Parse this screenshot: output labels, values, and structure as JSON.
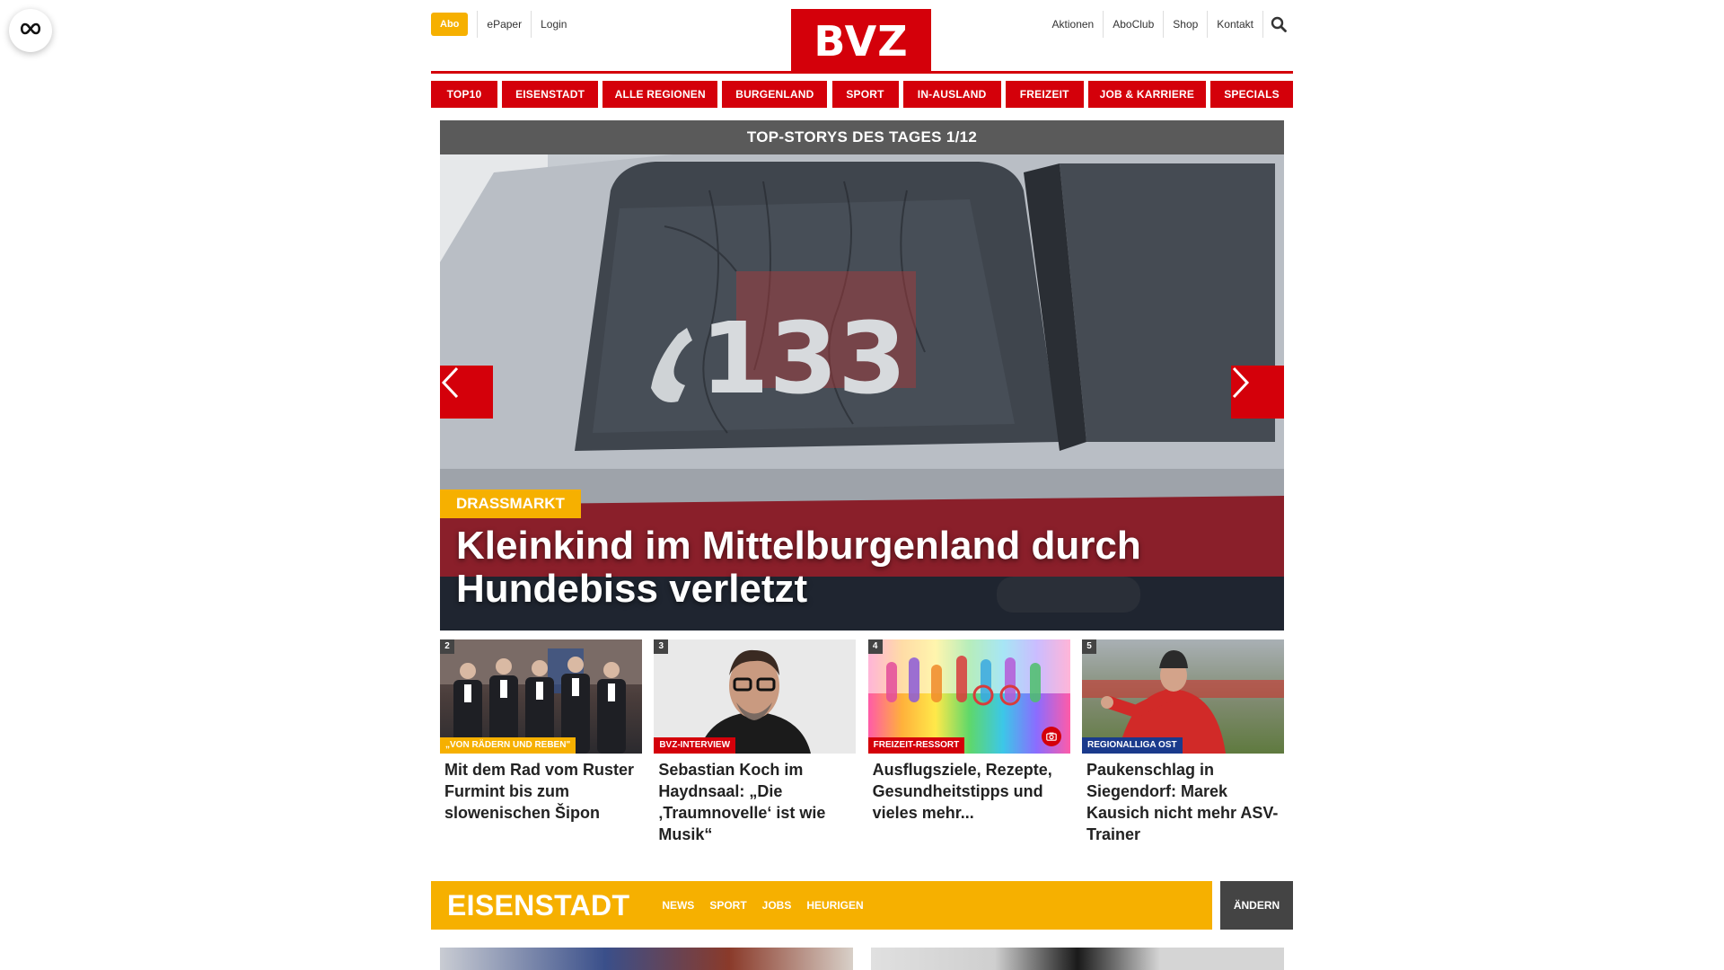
{
  "header": {
    "abo_label": "Abo",
    "left_links": [
      "ePaper",
      "Login"
    ],
    "logo_text": "BVZ",
    "right_links": [
      "Aktionen",
      "AboClub",
      "Shop",
      "Kontakt"
    ]
  },
  "nav": {
    "categories": [
      "TOP10",
      "EISENSTADT",
      "ALLE REGIONEN",
      "BURGENLAND",
      "SPORT",
      "IN-AUSLAND",
      "FREIZEIT",
      "JOB & KARRIERE",
      "SPECIALS"
    ]
  },
  "hero": {
    "heading": "TOP-STORYS DES TAGES 1/12",
    "tag": "DRASSMARKT",
    "title": "Kleinkind im Mittelburgenland durch Hundebiss verletzt",
    "car_number": "133"
  },
  "teasers": [
    {
      "num": "2",
      "tag": "„VON RÄDERN UND REBEN\"",
      "tag_color": "#f6b000",
      "title": "Mit dem Rad vom Ruster Furmint bis zum slowenischen Šipon"
    },
    {
      "num": "3",
      "tag": "BVZ-INTERVIEW",
      "tag_color": "#d4000a",
      "title": "Sebastian Koch im Haydnsaal: „Die ‚Traumnovelle‘ ist wie Musik“"
    },
    {
      "num": "4",
      "tag": "FREIZEIT-RESSORT",
      "tag_color": "#d4000a",
      "title": "Ausflugsziele, Rezepte, Gesundheitstipps und vieles mehr..."
    },
    {
      "num": "5",
      "tag": "REGIONALLIGA OST",
      "tag_color": "#1a3a8c",
      "title": "Paukenschlag in Siegendorf: Marek Kausich nicht mehr ASV-Trainer"
    }
  ],
  "region": {
    "title": "EISENSTADT",
    "links": [
      "NEWS",
      "SPORT",
      "JOBS",
      "HEURIGEN"
    ],
    "change_label": "ÄNDERN"
  },
  "colors": {
    "brand_red": "#d4000a",
    "accent_yellow": "#f6b000",
    "dark_gray": "#444444"
  }
}
